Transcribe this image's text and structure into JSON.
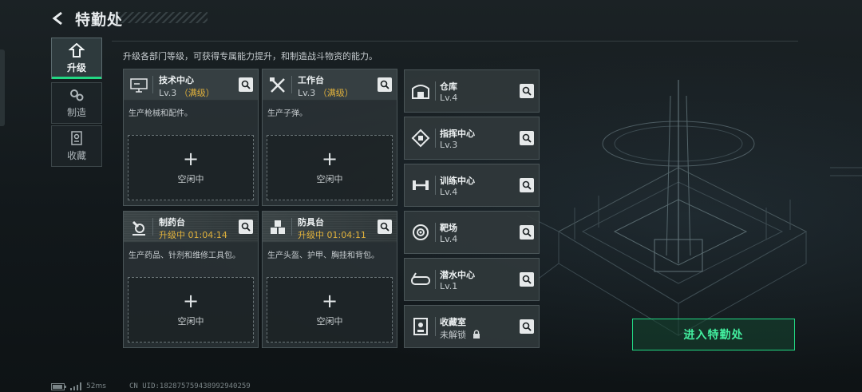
{
  "header": {
    "title": "特勤处"
  },
  "sidebar": {
    "items": [
      {
        "label": "升级",
        "icon": "upgrade-icon",
        "active": true
      },
      {
        "label": "制造",
        "icon": "gears-icon",
        "active": false
      },
      {
        "label": "收藏",
        "icon": "collection-icon",
        "active": false
      }
    ]
  },
  "description": "升级各部门等级，可获得专属能力提升，和制造战斗物资的能力。",
  "workshops": [
    {
      "name": "技术中心",
      "level": "Lv.3",
      "max_tag": "（满级）",
      "desc": "生产枪械和配件。",
      "slot_plus": "+",
      "slot_status": "空闲中",
      "icon": "computer-icon"
    },
    {
      "name": "工作台",
      "level": "Lv.3",
      "max_tag": "（满级）",
      "desc": "生产子弹。",
      "slot_plus": "+",
      "slot_status": "空闲中",
      "icon": "tools-icon"
    },
    {
      "name": "制药台",
      "level": "升级中 01:04:14",
      "desc": "生产药品、针剂和维修工具包。",
      "slot_plus": "+",
      "slot_status": "空闲中",
      "icon": "microscope-icon"
    },
    {
      "name": "防具台",
      "level": "升级中 01:04:11",
      "desc": "生产头盔、护甲、胸挂和背包。",
      "slot_plus": "+",
      "slot_status": "空闲中",
      "icon": "armor-icon"
    }
  ],
  "facilities": [
    {
      "name": "仓库",
      "level": "Lv.4",
      "icon": "warehouse-icon"
    },
    {
      "name": "指挥中心",
      "level": "Lv.3",
      "icon": "command-icon"
    },
    {
      "name": "训练中心",
      "level": "Lv.4",
      "icon": "dumbbell-icon"
    },
    {
      "name": "靶场",
      "level": "Lv.4",
      "icon": "target-icon"
    },
    {
      "name": "潜水中心",
      "level": "Lv.1",
      "icon": "diving-mask-icon"
    },
    {
      "name": "收藏室",
      "level": "未解锁",
      "icon": "trophy-icon",
      "locked": true
    }
  ],
  "enter_button": "进入特勤处",
  "status_bar": {
    "latency": "52ms",
    "uid": "CN UID:182875759438992940259"
  },
  "colors": {
    "accent": "#22d783",
    "max_level": "#e0b13c",
    "background": "#13191c"
  }
}
